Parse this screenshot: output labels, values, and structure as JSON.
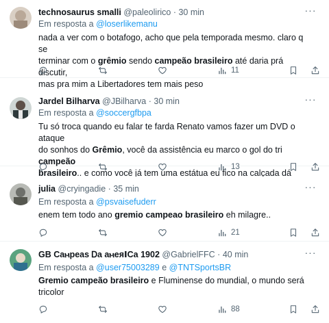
{
  "tweets": [
    {
      "name": "technosaurus smalli",
      "handle": "@paleolirico",
      "sep": "·",
      "time": "30 min",
      "reply_prefix": "Em resposta a",
      "reply_to": [
        "@loserlikemanu"
      ],
      "reply_joiner": "",
      "body_lines": [
        [
          {
            "t": "nada a ver com o botafogo, acho que pela temporada mesmo. claro q se"
          }
        ],
        [
          {
            "t": "terminar com o "
          },
          {
            "t": "grêmio",
            "b": true
          },
          {
            "t": " sendo "
          },
          {
            "t": "campeão brasileiro",
            "b": true
          },
          {
            "t": " até daria prá discutir,"
          }
        ],
        [
          {
            "t": "mas pra mim a Libertadores tem mais peso"
          }
        ]
      ],
      "views": "11",
      "avatar_color": "#c9b8a8"
    },
    {
      "name": "Jardel Bilharva",
      "handle": "@JBilharva",
      "sep": "·",
      "time": "30 min",
      "reply_prefix": "Em resposta a",
      "reply_to": [
        "@soccergfbpa"
      ],
      "reply_joiner": "",
      "body_lines": [
        [
          {
            "t": "Tu  só troca quando eu falar te farda Renato vamos fazer um DVD o ataque"
          }
        ],
        [
          {
            "t": "do sonhos do "
          },
          {
            "t": "Grêmio",
            "b": true
          },
          {
            "t": ", você da assistência eu marco o gol do tri "
          },
          {
            "t": "campeão",
            "b": true
          }
        ],
        [
          {
            "t": "brasileiro",
            "b": true
          },
          {
            "t": ".. e como você já tem uma estátua eu fico na calçada dá fama.."
          }
        ]
      ],
      "views": "13",
      "avatar_color": "#6f7f7a"
    },
    {
      "name": "julia",
      "handle": "@cryingadie",
      "sep": "·",
      "time": "35 min",
      "reply_prefix": "Em resposta a",
      "reply_to": [
        "@psvaisefuderr"
      ],
      "reply_joiner": "",
      "body_lines": [
        [
          {
            "t": "enem tem todo ano "
          },
          {
            "t": "gremio campeao brasileiro",
            "b": true
          },
          {
            "t": " eh milagre.."
          }
        ]
      ],
      "views": "21",
      "avatar_color": "#8d8f8a"
    },
    {
      "name": "GB Ϲаⲙреаѕ Ꭰа аⲙеяⅠϹа 1902",
      "handle": "@GabrielFFC",
      "sep": "·",
      "time": "40 min",
      "reply_prefix": "Em resposta a",
      "reply_to": [
        "@user75003289",
        "@TNTSportsBR"
      ],
      "reply_joiner": "e",
      "body_lines": [
        [
          {
            "t": "Gremio campeão brasileiro",
            "b": true
          },
          {
            "t": " e Fluminense do mundial, o mundo será"
          }
        ],
        [
          {
            "t": "tricolor"
          }
        ]
      ],
      "views": "88",
      "avatar_color": "#3f8f6a"
    }
  ],
  "colors": {
    "link": "#1d9bf0",
    "muted": "#536471",
    "text": "#0f1419"
  },
  "icons": [
    "more-icon",
    "reply-icon",
    "retweet-icon",
    "like-icon",
    "views-icon",
    "bookmark-icon",
    "share-icon"
  ]
}
